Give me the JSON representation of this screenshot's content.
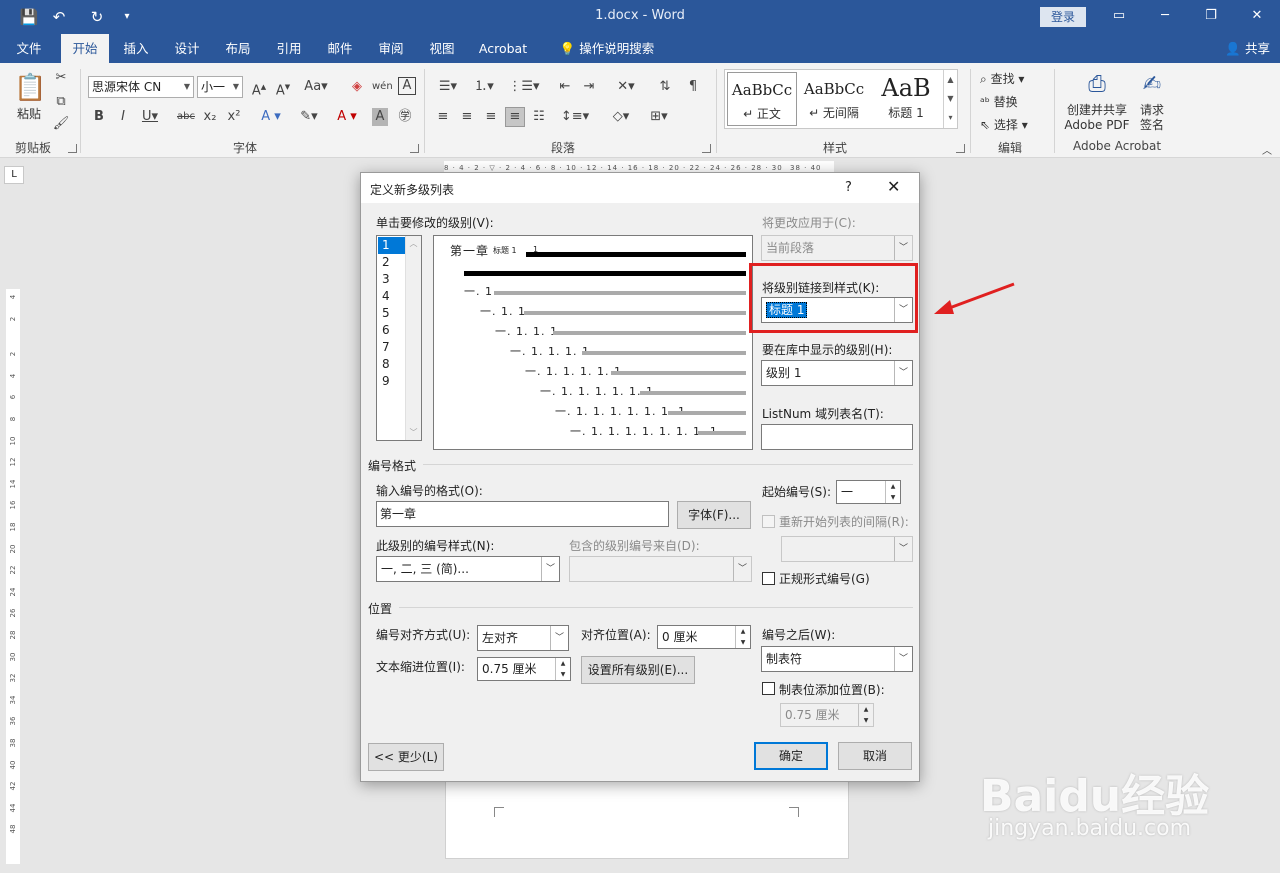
{
  "titlebar": {
    "doc_title": "1.docx - Word",
    "login": "登录",
    "qa_save": "💾",
    "qa_undo": "↶",
    "qa_redo": "↻",
    "qa_more": "▾"
  },
  "menu": {
    "tabs": [
      "文件",
      "开始",
      "插入",
      "设计",
      "布局",
      "引用",
      "邮件",
      "审阅",
      "视图",
      "Acrobat"
    ],
    "tell_me": "操作说明搜索",
    "share": "共享"
  },
  "ribbon": {
    "clipboard": {
      "paste": "粘贴",
      "label": "剪贴板"
    },
    "font": {
      "name": "思源宋体 CN",
      "size": "小一",
      "label": "字体"
    },
    "paragraph": {
      "label": "段落"
    },
    "styles": {
      "label": "样式",
      "items": [
        {
          "sample": "AaBbCc",
          "name": "↵ 正文"
        },
        {
          "sample": "AaBbCc",
          "name": "↵ 无间隔"
        },
        {
          "sample": "AaB",
          "name": "标题 1"
        }
      ]
    },
    "editing": {
      "find": "查找",
      "replace": "替换",
      "select": "选择",
      "label": "编辑"
    },
    "acrobat": {
      "create_share": "创建并共享",
      "create_share2": "Adobe PDF",
      "request": "请求",
      "sign": "签名",
      "label": "Adobe Acrobat"
    }
  },
  "ruler": {
    "horizontal": "8 · 4 · 2 · ▽ · 2 · 4 · 6 · 8 · 10 · 12 · 14 · 16 · 18 · 20 · 22 · 24 · 26 · 28 · 30",
    "horizontal_right": "38 · 40",
    "corner": "L",
    "vertical": [
      "4",
      "2",
      "2",
      "4",
      "6",
      "8",
      "10",
      "12",
      "14",
      "16",
      "18",
      "20",
      "22",
      "24",
      "26",
      "28",
      "30",
      "32",
      "34",
      "36",
      "38",
      "40",
      "42",
      "44",
      "48"
    ]
  },
  "dialog": {
    "title": "定义新多级列表",
    "help": "?",
    "close": "✕",
    "click_level_label": "单击要修改的级别(V):",
    "levels": [
      "1",
      "2",
      "3",
      "4",
      "5",
      "6",
      "7",
      "8",
      "9"
    ],
    "selected_level": "1",
    "preview": {
      "lines": [
        "第一章",
        "",
        "一. 1",
        "一. 1. 1",
        "一. 1. 1. 1",
        "一. 1. 1. 1. 1",
        "一. 1. 1. 1. 1. 1",
        "一. 1. 1. 1. 1. 1. 1",
        "一. 1. 1. 1. 1. 1. 1. 1",
        "一. 1. 1. 1. 1. 1. 1. 1. 1"
      ],
      "first_line_style": "标题 1"
    },
    "apply_to_label": "将更改应用于(C):",
    "apply_to_value": "当前段落",
    "link_style_label": "将级别链接到样式(K):",
    "link_style_value": "标题 1",
    "gallery_level_label": "要在库中显示的级别(H):",
    "gallery_level_value": "级别 1",
    "listnum_label": "ListNum 域列表名(T):",
    "listnum_value": "",
    "number_format_section": "编号格式",
    "enter_format_label": "输入编号的格式(O):",
    "enter_format_value": "第一章",
    "font_button": "字体(F)...",
    "start_at_label": "起始编号(S):",
    "start_at_value": "一",
    "restart_label": "重新开始列表的间隔(R):",
    "number_style_label": "此级别的编号样式(N):",
    "number_style_value": "一, 二, 三 (简)...",
    "include_level_label": "包含的级别编号来自(D):",
    "legal_label": "正规形式编号(G)",
    "position_section": "位置",
    "alignment_label": "编号对齐方式(U):",
    "alignment_value": "左对齐",
    "aligned_at_label": "对齐位置(A):",
    "aligned_at_value": "0 厘米",
    "indent_label": "文本缩进位置(I):",
    "indent_value": "0.75 厘米",
    "set_all_button": "设置所有级别(E)...",
    "follow_label": "编号之后(W):",
    "follow_value": "制表符",
    "tab_stop_label": "制表位添加位置(B):",
    "tab_stop_value": "0.75 厘米",
    "less_button": "<< 更少(L)",
    "ok_button": "确定",
    "cancel_button": "取消"
  },
  "colors": {
    "word_blue": "#2b579a",
    "highlight_red": "#e02020",
    "selection_blue": "#0078d7"
  },
  "watermark": {
    "main": "Baidu经验",
    "url": "jingyan.baidu.com"
  }
}
